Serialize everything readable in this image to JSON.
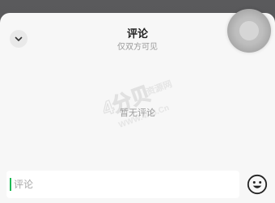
{
  "header": {
    "title": "评论",
    "subtitle": "仅双方可见"
  },
  "comments": {
    "empty_text": "暂无评论"
  },
  "composer": {
    "placeholder": "评论",
    "value": ""
  },
  "watermark": {
    "text_large": "4分贝",
    "text_cn": "资源网",
    "text_url": "WWW.4FB.Cn"
  },
  "icons": {
    "collapse": "chevron-down-icon",
    "emoji": "smiley-face-icon",
    "floating": "floating-ball-icon"
  },
  "colors": {
    "caret_accent": "#1db954"
  }
}
